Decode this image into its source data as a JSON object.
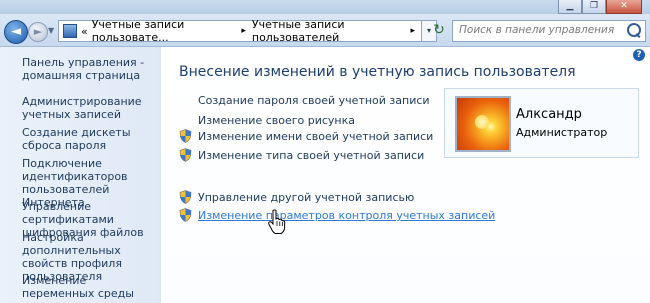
{
  "window": {
    "buttons": {
      "minimize": "▁",
      "maximize": "❐",
      "close": "✕"
    }
  },
  "address_bar": {
    "chevrons": "«",
    "crumbs": [
      "Учетные записи пользовате...",
      "Учетные записи пользователей"
    ],
    "separator": "▸",
    "dropdown": "▾",
    "refresh_icon": "↻"
  },
  "search": {
    "placeholder": "Поиск в панели управления"
  },
  "sidebar": {
    "items": [
      {
        "label": "Панель управления - домашняя страница"
      },
      {
        "label": "Администрирование учетных записей"
      },
      {
        "label": "Создание дискеты сброса пароля"
      },
      {
        "label": "Подключение идентификаторов пользователей Интернета"
      },
      {
        "label": "Управление сертификатами шифрования файлов"
      },
      {
        "label": "Настройка дополнительных свойств профиля пользователя"
      },
      {
        "label": "Изменение переменных среды"
      }
    ]
  },
  "main": {
    "help": "?",
    "heading": "Внесение изменений в учетную запись пользователя",
    "tasks": [
      {
        "label": "Создание пароля своей учетной записи",
        "shield": false
      },
      {
        "label": "Изменение своего рисунка",
        "shield": false
      },
      {
        "label": "Изменение имени своей учетной записи",
        "shield": true
      },
      {
        "label": "Изменение типа своей учетной записи",
        "shield": true
      },
      {
        "label": "Управление другой учетной записью",
        "shield": true
      },
      {
        "label": "Изменение параметров контроля учетных записей",
        "shield": true,
        "hover": true
      }
    ],
    "user": {
      "name": "Алксандр",
      "role": "Администратор"
    }
  },
  "colors": {
    "link": "#1e395b",
    "link_hover": "#2e7ad8",
    "sidebar_bg": "#e3ecf7"
  }
}
